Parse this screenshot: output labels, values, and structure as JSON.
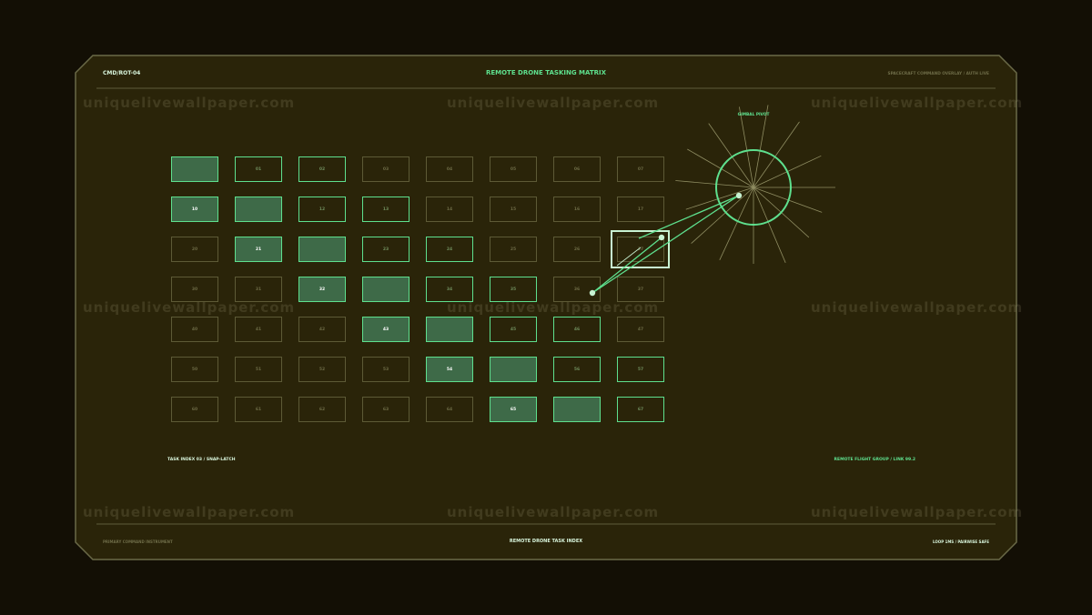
{
  "header": {
    "left_code": "CMD/ROT-04",
    "title": "REMOTE DRONE TASKING MATRIX",
    "right_status": "SPACECRAFT COMMAND OVERLAY / AUTH LIVE"
  },
  "gimbal": {
    "label": "GIMBAL PIVOT"
  },
  "panel_labels": {
    "left": "TASK INDEX 03 / SNAP-LATCH",
    "right": "REMOTE FLIGHT GROUP / LINK 99.2"
  },
  "footer": {
    "left": "PRIMARY COMMAND INSTRUMENT",
    "center": "REMOTE DRONE TASK INDEX",
    "right": "LOOP 1MS / PAIRWISE SAFE"
  },
  "watermark": "uniquelivewallpaper.com",
  "colors": {
    "background": "#130f05",
    "panel": "#2a2409",
    "accent_green": "#5ee08e",
    "cell_fill": "#3e6a48",
    "dim_border": "#5d5a36"
  },
  "grid": {
    "rows": [
      [
        {
          "label": "",
          "state": "fill"
        },
        {
          "label": "01",
          "state": "line"
        },
        {
          "label": "02",
          "state": "line"
        },
        {
          "label": "03",
          "state": "dim"
        },
        {
          "label": "04",
          "state": "dim"
        },
        {
          "label": "05",
          "state": "dim"
        },
        {
          "label": "06",
          "state": "dim"
        },
        {
          "label": "07",
          "state": "dim"
        }
      ],
      [
        {
          "label": "10",
          "state": "fill"
        },
        {
          "label": "",
          "state": "fill"
        },
        {
          "label": "12",
          "state": "line"
        },
        {
          "label": "13",
          "state": "line"
        },
        {
          "label": "14",
          "state": "dim"
        },
        {
          "label": "15",
          "state": "dim"
        },
        {
          "label": "16",
          "state": "dim"
        },
        {
          "label": "17",
          "state": "dim"
        }
      ],
      [
        {
          "label": "20",
          "state": "dim"
        },
        {
          "label": "21",
          "state": "fill"
        },
        {
          "label": "",
          "state": "fill"
        },
        {
          "label": "23",
          "state": "line"
        },
        {
          "label": "24",
          "state": "line"
        },
        {
          "label": "25",
          "state": "dim"
        },
        {
          "label": "26",
          "state": "dim"
        },
        {
          "label": "27",
          "state": "dim"
        }
      ],
      [
        {
          "label": "30",
          "state": "dim"
        },
        {
          "label": "31",
          "state": "dim"
        },
        {
          "label": "32",
          "state": "fill"
        },
        {
          "label": "",
          "state": "fill"
        },
        {
          "label": "34",
          "state": "line"
        },
        {
          "label": "35",
          "state": "line"
        },
        {
          "label": "36",
          "state": "dim"
        },
        {
          "label": "37",
          "state": "dim"
        }
      ],
      [
        {
          "label": "40",
          "state": "dim"
        },
        {
          "label": "41",
          "state": "dim"
        },
        {
          "label": "42",
          "state": "dim"
        },
        {
          "label": "43",
          "state": "fill"
        },
        {
          "label": "",
          "state": "fill"
        },
        {
          "label": "45",
          "state": "line"
        },
        {
          "label": "46",
          "state": "line"
        },
        {
          "label": "47",
          "state": "dim"
        }
      ],
      [
        {
          "label": "50",
          "state": "dim"
        },
        {
          "label": "51",
          "state": "dim"
        },
        {
          "label": "52",
          "state": "dim"
        },
        {
          "label": "53",
          "state": "dim"
        },
        {
          "label": "54",
          "state": "fill"
        },
        {
          "label": "",
          "state": "fill"
        },
        {
          "label": "56",
          "state": "line"
        },
        {
          "label": "57",
          "state": "line"
        }
      ],
      [
        {
          "label": "60",
          "state": "dim"
        },
        {
          "label": "61",
          "state": "dim"
        },
        {
          "label": "62",
          "state": "dim"
        },
        {
          "label": "63",
          "state": "dim"
        },
        {
          "label": "64",
          "state": "dim"
        },
        {
          "label": "65",
          "state": "fill"
        },
        {
          "label": "",
          "state": "fill"
        },
        {
          "label": "67",
          "state": "line"
        }
      ]
    ]
  }
}
